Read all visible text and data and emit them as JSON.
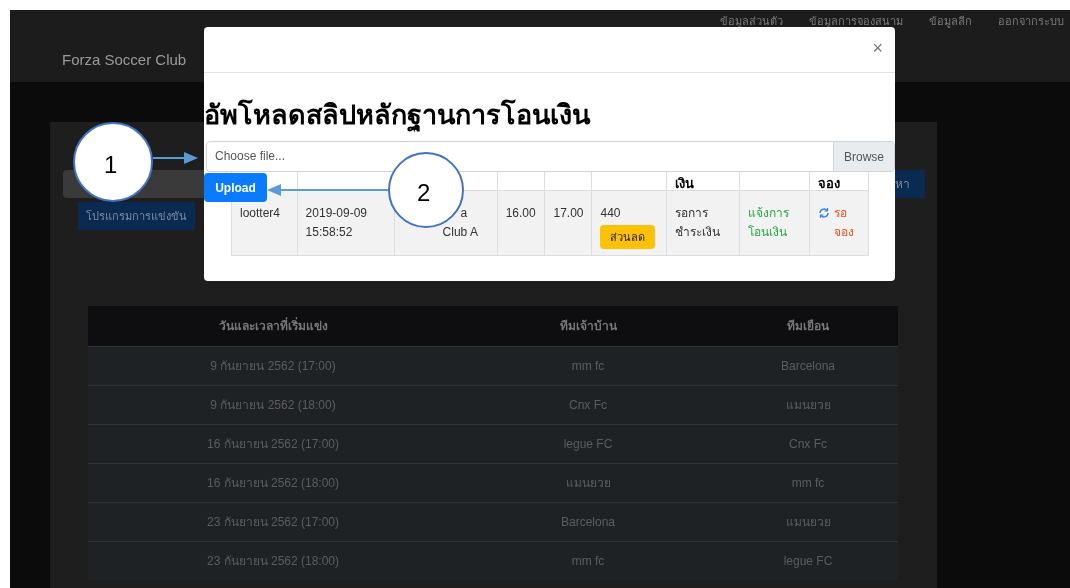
{
  "navbar": {
    "brand": "Forza Soccer Club",
    "links": [
      "ข้อมูลส่วนตัว",
      "ข้อมูลการจองสนาม",
      "ข้อมูลลีก",
      "ออกจากระบบ"
    ]
  },
  "page": {
    "program_button": "โปรแกรมการแข่งขัน",
    "search_button": "หา",
    "matches": {
      "columns": [
        "วันและเวลาที่เริ่มแข่ง",
        "ทีมเจ้าบ้าน",
        "ทีมเยือน"
      ],
      "rows": [
        [
          "9 กันยายน 2562 (17:00)",
          "mm fc",
          "Barcelona"
        ],
        [
          "9 กันยายน 2562 (18:00)",
          "Cnx Fc",
          "แมนยวย"
        ],
        [
          "16 กันยายน 2562 (17:00)",
          "legue FC",
          "Cnx Fc"
        ],
        [
          "16 กันยายน 2562 (18:00)",
          "แมนยวย",
          "mm fc"
        ],
        [
          "23 กันยายน 2562 (17:00)",
          "Barcelona",
          "แมนยวย"
        ],
        [
          "23 กันยายน 2562 (18:00)",
          "mm fc",
          "legue FC"
        ]
      ]
    }
  },
  "modal": {
    "close": "×",
    "title": "อัพโหลดสลิปหลักฐานการโอนเงิน",
    "file_placeholder": "Choose file...",
    "browse": "Browse",
    "upload": "Upload",
    "table": {
      "column_7_header": "เงิน",
      "column_9_header": "จอง",
      "row": {
        "user": "lootter4",
        "date": "2019-09-09",
        "time": "15:58:52",
        "field_line_1": "a",
        "field_line_2": "Club A",
        "start": "16.00",
        "end": "17.00",
        "price": "440",
        "badge": "ส่วนลด",
        "status": "รอการชำระเงิน",
        "action": "แจ้งการโอนเงิน",
        "booking": "รอจอง"
      }
    }
  },
  "callouts": [
    {
      "label": "1"
    },
    {
      "label": "2"
    }
  ]
}
